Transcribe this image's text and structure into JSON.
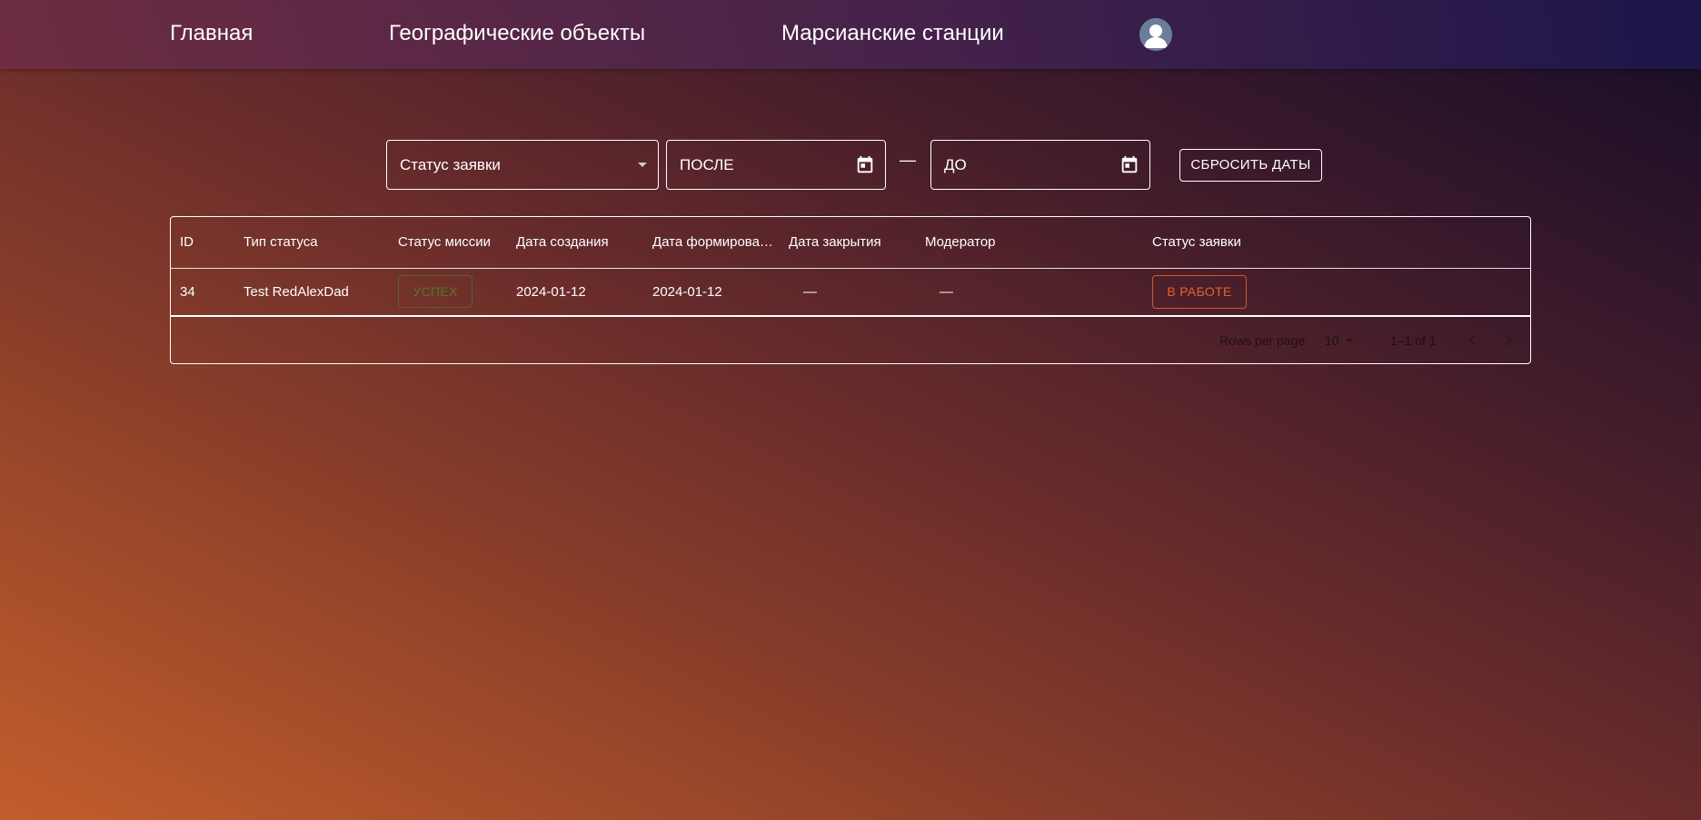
{
  "nav": {
    "home": "Главная",
    "geo_objects": "Географические объекты",
    "mars_stations": "Марсианские станции"
  },
  "filters": {
    "status_label": "Статус заявки",
    "date_from": "ПОСЛЕ",
    "separator": "—",
    "date_to": "ДО",
    "reset_label": "СБРОСИТЬ ДАТЫ"
  },
  "table": {
    "columns": [
      "ID",
      "Тип статуса",
      "Статус миссии",
      "Дата создания",
      "Дата формирова…",
      "Дата закрытия",
      "Модератор",
      "Статус заявки"
    ],
    "rows": [
      {
        "id": "34",
        "status_type": "Test RedAlexDad",
        "mission_status": "УСПЕХ",
        "created": "2024-01-12",
        "formed": "2024-01-12",
        "closed": "—",
        "moderator": "—",
        "request_status": "В РАБОТЕ"
      }
    ]
  },
  "pagination": {
    "rows_per_page_label": "Rows per page:",
    "rows_per_page": "10",
    "range": "1–1 of 1"
  },
  "colors": {
    "success": "#4f7a2a",
    "in_work": "#e2622e"
  }
}
